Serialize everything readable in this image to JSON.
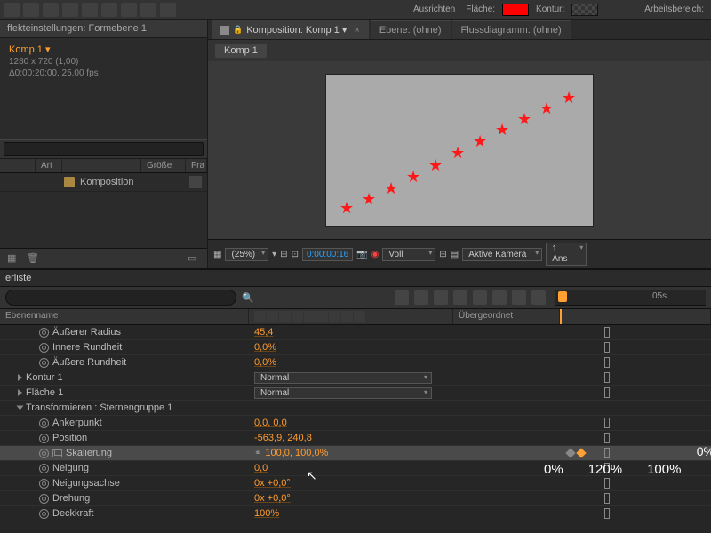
{
  "toolbar": {
    "align_label": "Ausrichten",
    "fill_label": "Fläche:",
    "stroke_label": "Kontur:",
    "workspace_label": "Arbeitsbereich:"
  },
  "left": {
    "tab": "ffekteinstellungen: Formebene 1",
    "comp_name": "Komp 1 ▾",
    "dims": "1280 x 720 (1,00)",
    "duration": "Δ0:00:20:00, 25,00 fps",
    "col_art": "Art",
    "col_size": "Größe",
    "col_fra": "Fra",
    "item_name": "Komposition"
  },
  "viewer": {
    "tab_comp": "Komposition: Komp 1 ▾",
    "tab_layer": "Ebene: (ohne)",
    "tab_flow": "Flussdiagramm: (ohne)",
    "crumb": "Komp 1",
    "zoom": "(25%)",
    "timecode": "0:00:00:16",
    "mode": "Voll",
    "camera": "Aktive Kamera",
    "views": "1 Ans"
  },
  "timeline": {
    "tab": "erliste",
    "time_05s": "05s",
    "col_name": "Ebenenname",
    "col_parent": "Übergeordnet",
    "pct_0": "0%",
    "pct_120": "120%",
    "pct_100": "100%"
  },
  "props": [
    {
      "indent": 32,
      "stopwatch": true,
      "name": "Äußerer Radius",
      "val": "45,4",
      "track": "i"
    },
    {
      "indent": 32,
      "stopwatch": true,
      "name": "Innere Rundheit",
      "val": "0,0%",
      "track": "i"
    },
    {
      "indent": 32,
      "stopwatch": true,
      "name": "Äußere Rundheit",
      "val": "0,0%",
      "track": "i"
    },
    {
      "indent": 8,
      "tri": true,
      "name": "Kontur 1",
      "dd": "Normal",
      "track": "i"
    },
    {
      "indent": 8,
      "tri": true,
      "name": "Fläche 1",
      "dd": "Normal",
      "track": "i"
    },
    {
      "indent": 8,
      "tri": true,
      "open": true,
      "name": "Transformieren : Sternengruppe 1"
    },
    {
      "indent": 32,
      "stopwatch": true,
      "name": "Ankerpunkt",
      "val": "0,0, 0,0",
      "track": "i"
    },
    {
      "indent": 32,
      "stopwatch": true,
      "name": "Position",
      "val": "-563,9, 240,8",
      "track": "i"
    },
    {
      "indent": 32,
      "stopwatch": true,
      "graph": true,
      "name": "Skalierung",
      "link": true,
      "val": "100,0, 100,0%",
      "track": "keys",
      "sel": true
    },
    {
      "indent": 32,
      "stopwatch": true,
      "name": "Neigung",
      "val": "0,0",
      "track": "i"
    },
    {
      "indent": 32,
      "stopwatch": true,
      "name": "Neigungsachse",
      "val": "0x +0,0°",
      "track": "i"
    },
    {
      "indent": 32,
      "stopwatch": true,
      "name": "Drehung",
      "val": "0x +0,0°",
      "track": "i"
    },
    {
      "indent": 32,
      "stopwatch": true,
      "name": "Deckkraft",
      "val": "100%",
      "track": "i"
    }
  ]
}
